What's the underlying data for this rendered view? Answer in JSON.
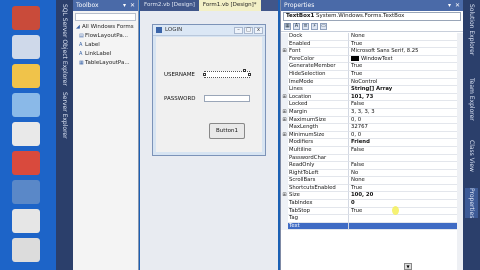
{
  "desktop": {
    "icons": [
      {
        "name": "shortcut-icon",
        "color": "#c94b3a"
      },
      {
        "name": "shortcut-icon",
        "color": "#cfd9ea"
      },
      {
        "name": "shortcut-icon",
        "color": "#f0c34a"
      },
      {
        "name": "shortcut-icon",
        "color": "#8ab9e8"
      },
      {
        "name": "shortcut-icon",
        "color": "#e9e9e9"
      },
      {
        "name": "shortcut-icon",
        "color": "#d94a3d"
      },
      {
        "name": "shortcut-icon",
        "color": "#5a88c8"
      },
      {
        "name": "shortcut-icon",
        "color": "#e6e6e6"
      },
      {
        "name": "shortcut-icon",
        "color": "#dcdcdc"
      }
    ]
  },
  "left_side_tabs": [
    "SQL Server Object Explorer",
    "Server Explorer"
  ],
  "right_side_tabs": [
    "Solution Explorer",
    "Team Explorer",
    "Class View",
    "Properties"
  ],
  "toolbox": {
    "title": "Toolbox",
    "title_buttons": "▾ ✕",
    "group": "All Windows Forms",
    "items": [
      "FlowLayoutPa...",
      "Label",
      "LinkLabel",
      "TableLayoutPa..."
    ]
  },
  "editor": {
    "tabs": [
      "Form2.vb [Design]",
      "Form1.vb [Design]*"
    ],
    "form": {
      "caption": "LOGIN",
      "labels": {
        "username": "USERNAME",
        "password": "PASSWORD"
      },
      "button": "Button1"
    }
  },
  "properties": {
    "title": "Properties",
    "title_buttons": "▾ ✕",
    "object": "TextBox1",
    "object_type": "System.Windows.Forms.TextBox",
    "rows": [
      {
        "exp": "",
        "name": "Dock",
        "value": "None",
        "bold": false
      },
      {
        "exp": "",
        "name": "Enabled",
        "value": "True",
        "bold": false
      },
      {
        "exp": "⊞",
        "name": "Font",
        "value": "Microsoft Sans Serif, 8.25",
        "bold": false
      },
      {
        "exp": "",
        "name": "ForeColor",
        "value": "WindowText",
        "bold": false,
        "swatch": "#000000"
      },
      {
        "exp": "",
        "name": "GenerateMember",
        "value": "True",
        "bold": false
      },
      {
        "exp": "",
        "name": "HideSelection",
        "value": "True",
        "bold": false
      },
      {
        "exp": "",
        "name": "ImeMode",
        "value": "NoControl",
        "bold": false
      },
      {
        "exp": "",
        "name": "Lines",
        "value": "String[] Array",
        "bold": true
      },
      {
        "exp": "⊞",
        "name": "Location",
        "value": "101, 73",
        "bold": true
      },
      {
        "exp": "",
        "name": "Locked",
        "value": "False",
        "bold": false
      },
      {
        "exp": "⊞",
        "name": "Margin",
        "value": "3, 3, 3, 3",
        "bold": false
      },
      {
        "exp": "⊞",
        "name": "MaximumSize",
        "value": "0, 0",
        "bold": false
      },
      {
        "exp": "",
        "name": "MaxLength",
        "value": "32767",
        "bold": false
      },
      {
        "exp": "⊞",
        "name": "MinimumSize",
        "value": "0, 0",
        "bold": false
      },
      {
        "exp": "",
        "name": "Modifiers",
        "value": "Friend",
        "bold": true
      },
      {
        "exp": "",
        "name": "Multiline",
        "value": "False",
        "bold": false
      },
      {
        "exp": "",
        "name": "PasswordChar",
        "value": "",
        "bold": false
      },
      {
        "exp": "",
        "name": "ReadOnly",
        "value": "False",
        "bold": false
      },
      {
        "exp": "",
        "name": "RightToLeft",
        "value": "No",
        "bold": false
      },
      {
        "exp": "",
        "name": "ScrollBars",
        "value": "None",
        "bold": false
      },
      {
        "exp": "",
        "name": "ShortcutsEnabled",
        "value": "True",
        "bold": false
      },
      {
        "exp": "⊞",
        "name": "Size",
        "value": "100, 20",
        "bold": true
      },
      {
        "exp": "",
        "name": "TabIndex",
        "value": "0",
        "bold": true
      },
      {
        "exp": "",
        "name": "TabStop",
        "value": "True",
        "bold": false
      },
      {
        "exp": "",
        "name": "Tag",
        "value": "",
        "bold": false
      },
      {
        "exp": "",
        "name": "Text",
        "value": "",
        "bold": false,
        "selected": true
      }
    ]
  }
}
